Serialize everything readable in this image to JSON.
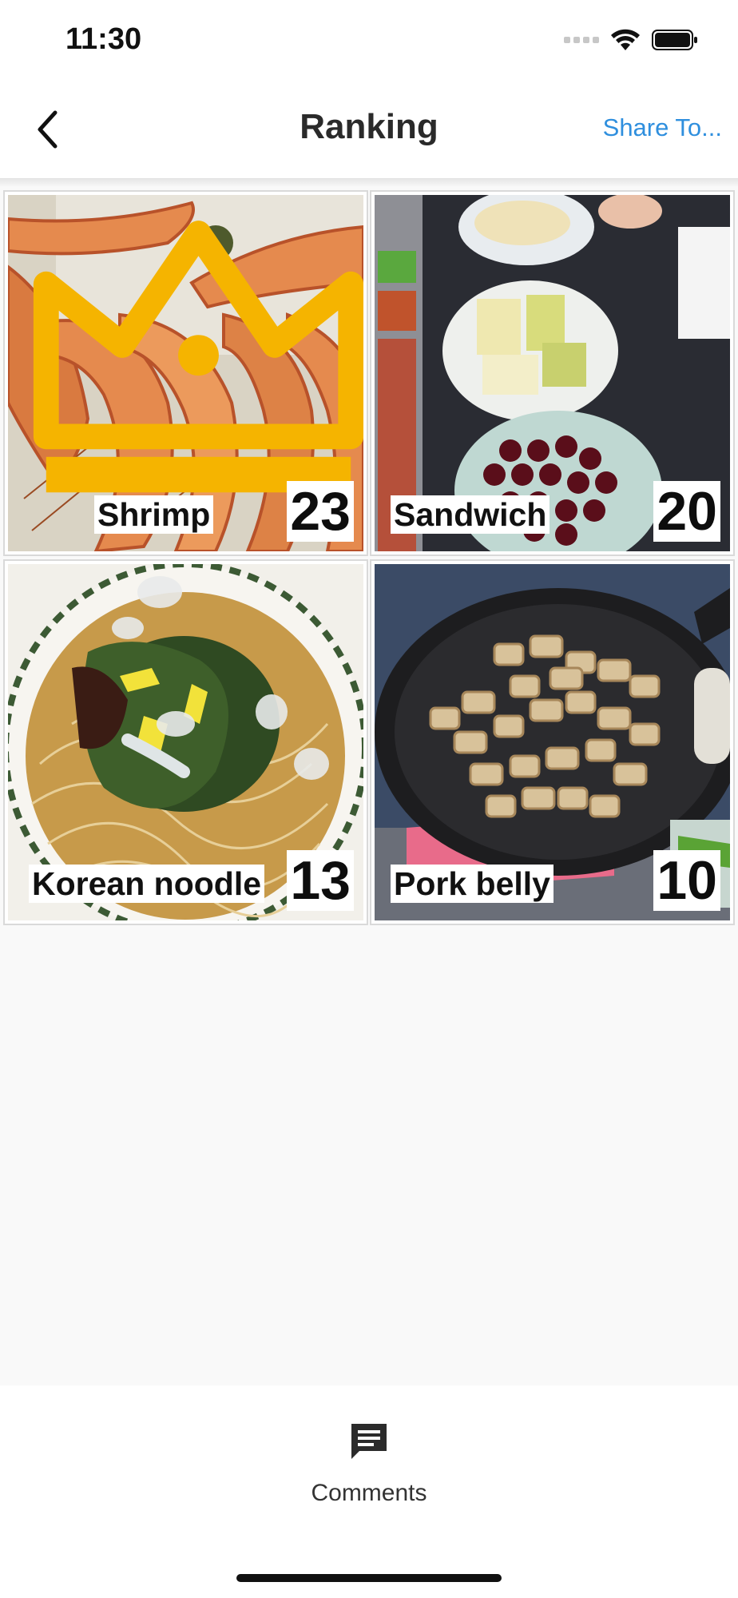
{
  "status_bar": {
    "time": "11:30"
  },
  "nav": {
    "back_icon": "chevron-left-icon",
    "title": "Ranking",
    "share_label": "Share To..."
  },
  "ranking": [
    {
      "name": "Shrimp",
      "count": "23",
      "crown": true
    },
    {
      "name": "Sandwich",
      "count": "20",
      "crown": false
    },
    {
      "name": "Korean noodle",
      "count": "13",
      "crown": false
    },
    {
      "name": "Pork belly",
      "count": "10",
      "crown": false
    }
  ],
  "bottom_bar": {
    "comments_icon": "chat-bubble-icon",
    "comments_label": "Comments"
  },
  "colors": {
    "accent": "#2f8fde",
    "crown": "#f5b400"
  }
}
